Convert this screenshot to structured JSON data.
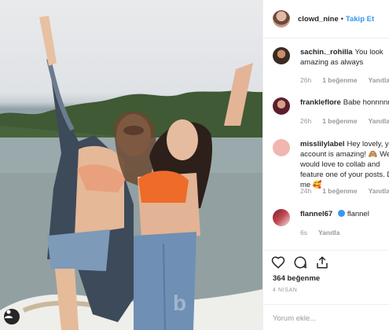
{
  "header": {
    "username": "clowd_nine",
    "separator": "•",
    "follow_label": "Takip Et"
  },
  "comments": [
    {
      "username": "sachin._rohilla",
      "text": "You look amazing as always",
      "time": "26h",
      "likes": "1 beğenme",
      "reply": "Yanıtla"
    },
    {
      "username": "frankleflore",
      "text": "Babe honnnnn",
      "time": "26h",
      "likes": "1 beğenme",
      "reply": "Yanıtla"
    },
    {
      "username": "misslilylabel",
      "text": "Hey lovely, your account is amazing! 🙈 We would love to collab and feature one of your posts. DM me 🥰",
      "time": "24h",
      "likes": "1 beğenme",
      "reply": "Yanıtla"
    },
    {
      "username": "flannel67",
      "text": "flannel",
      "time": "6s",
      "reply": "Yanıtla"
    }
  ],
  "actions": {
    "likes_count": "364 beğenme",
    "date": "4 NİSAN",
    "comment_placeholder": "Yorum ekle..."
  },
  "icons": [
    "heart-icon",
    "comment-icon",
    "share-icon",
    "verified-icon",
    "user-icon"
  ]
}
